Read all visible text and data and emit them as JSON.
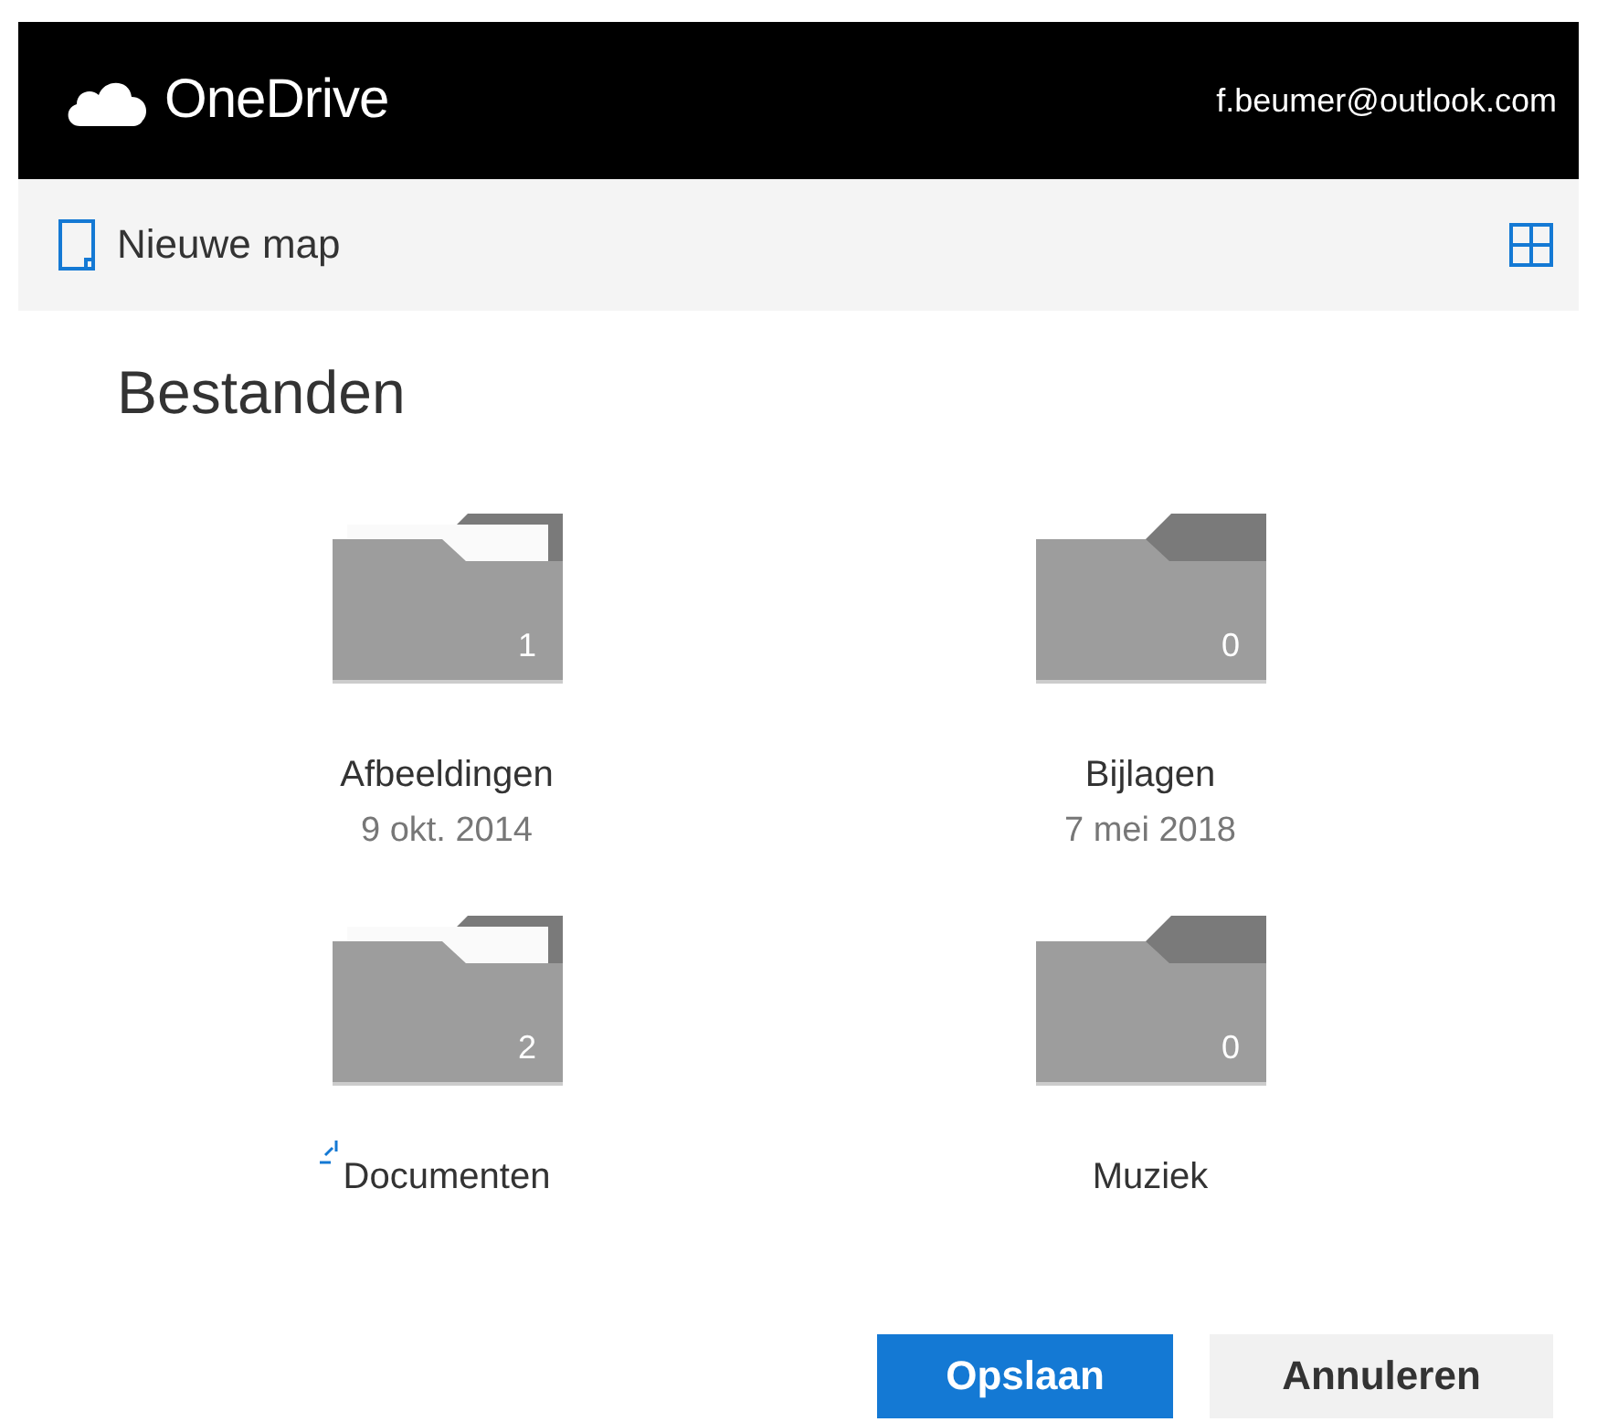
{
  "header": {
    "brand": "OneDrive",
    "account": "f.beumer@outlook.com"
  },
  "toolbar": {
    "new_folder": "Nieuwe map"
  },
  "title": "Bestanden",
  "folders": [
    {
      "name": "Afbeeldingen",
      "date": "9 okt. 2014",
      "count": "1",
      "has_content": true,
      "loading": false
    },
    {
      "name": "Bijlagen",
      "date": "7 mei 2018",
      "count": "0",
      "has_content": false,
      "loading": false
    },
    {
      "name": "Documenten",
      "count": "2",
      "has_content": true,
      "loading": true
    },
    {
      "name": "Muziek",
      "count": "0",
      "has_content": false,
      "loading": false
    }
  ],
  "buttons": [
    {
      "label": "Opslaan",
      "kind": "primary"
    },
    {
      "label": "Annuleren",
      "kind": "secondary"
    }
  ]
}
